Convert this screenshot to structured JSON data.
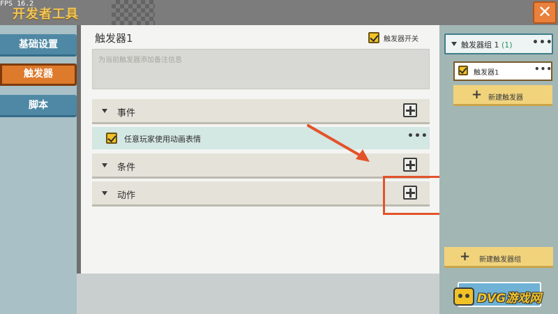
{
  "window": {
    "title": "开发者工具",
    "fps": "FPS 16.2",
    "close_icon": "close-icon (✕)"
  },
  "left_nav": {
    "items": [
      {
        "label": "基础设置",
        "active": false
      },
      {
        "label": "触发器",
        "active": true
      },
      {
        "label": "脚本",
        "active": false
      }
    ]
  },
  "editor": {
    "trigger_name": "触发器1",
    "switch": {
      "label": "触发器开关",
      "checked": true
    },
    "remark_placeholder": "为当前触发器添加备注信息",
    "sections": {
      "event": {
        "label": "事件"
      },
      "event_item": {
        "label": "任意玩家使用动画表情",
        "checked": true
      },
      "condition": {
        "label": "条件"
      },
      "action": {
        "label": "动作"
      }
    }
  },
  "right_panel": {
    "group": {
      "title": "触发器组 1",
      "count": "(1)"
    },
    "trigger_item": {
      "label": "触发器1",
      "checked": true
    },
    "new_trigger_label": "新建触发器",
    "new_group_label": "新建触发器组"
  },
  "watermark": {
    "text": "DVG游戏网"
  },
  "colors": {
    "accent_orange": "#dd7a2c",
    "nav_blue": "#4e88a4",
    "highlight_red": "#e3532a",
    "checkbox_yellow": "#f1c227",
    "button_yellow": "#f1d37c",
    "title_gold": "#f1c55a"
  }
}
